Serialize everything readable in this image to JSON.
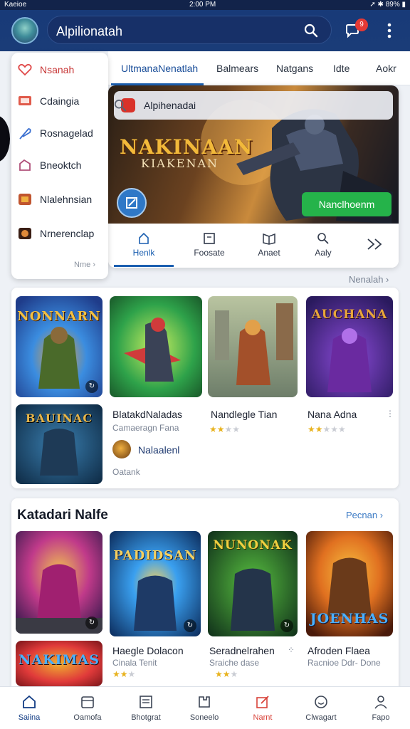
{
  "status_bar": {
    "left": "Kaeioe",
    "time": "2:00 PM",
    "right": "89%"
  },
  "app_bar": {
    "search_text": "Alpilionatah",
    "notification_badge": "9"
  },
  "top_tabs": [
    "UltmanaNenatlah",
    "Balmears",
    "Natgans",
    "Idte",
    "Aokr"
  ],
  "side_menu": {
    "items": [
      {
        "label": "Nsanah",
        "icon": "heart-icon",
        "color": "#e04848"
      },
      {
        "label": "Cdaingia",
        "icon": "tv-icon",
        "color": "#e05a4a"
      },
      {
        "label": "Rosnagelad",
        "icon": "feather-icon",
        "color": "#3a6fd0"
      },
      {
        "label": "Bneoktch",
        "icon": "controller-icon",
        "color": "#b0507a"
      },
      {
        "label": "Nlalehnsian",
        "icon": "game-thumb-icon",
        "color": "#c0552f"
      },
      {
        "label": "Nrnerenclap",
        "icon": "mask-icon",
        "color": "#8a4a2a"
      }
    ],
    "more": "Nme"
  },
  "hero": {
    "search_text": "Alpihenadai",
    "title": "NAKINAAN",
    "subtitle": "KIAKENAN",
    "cta": "Nanclhoenm",
    "nav": [
      {
        "label": "Henlk",
        "icon": "home-icon"
      },
      {
        "label": "Foosate",
        "icon": "square-icon"
      },
      {
        "label": "Anaet",
        "icon": "book-icon"
      },
      {
        "label": "Aaly",
        "icon": "search-icon"
      },
      {
        "label": "",
        "icon": "double-chevron-icon"
      }
    ]
  },
  "section1": {
    "see_all": "Nenalah",
    "covers": [
      {
        "title": "NONNARN",
        "colors": [
          "#1f3c8a",
          "#3b8de0",
          "#f0a030"
        ]
      },
      {
        "title": "",
        "colors": [
          "#2ea24a",
          "#c9ee60",
          "#d03b3b"
        ]
      },
      {
        "title": "",
        "colors": [
          "#6e7e6a",
          "#b9c4a0",
          "#a3502a"
        ]
      },
      {
        "title": "AUCHANA",
        "colors": [
          "#2a1a5e",
          "#8b4ad8",
          "#e8a63a"
        ]
      },
      {
        "title": "BAUINAC",
        "colors": [
          "#0e2a44",
          "#3a7fb0",
          "#e6b54a"
        ]
      }
    ],
    "featured": {
      "name": "BlatakdNaladas",
      "sub": "Camaeragn Fana",
      "dev": "Nalaalenl",
      "extra": "Oatank"
    },
    "games": [
      {
        "name": "Nandlegle Tian",
        "stars": 2
      },
      {
        "name": "Nana Adna",
        "stars": 2
      }
    ]
  },
  "section2": {
    "title": "Katadari Nalfe",
    "see_all": "Pecnan",
    "covers": [
      {
        "title": "",
        "colors": [
          "#3a1a4e",
          "#c03a8a",
          "#f0c050"
        ]
      },
      {
        "title": "PADIDSAN",
        "colors": [
          "#0c2c5c",
          "#3aa0f0",
          "#f4d060"
        ]
      },
      {
        "title": "NUNONAK",
        "colors": [
          "#10301a",
          "#58c040",
          "#f0d040"
        ]
      },
      {
        "title": "JOENHAS",
        "colors": [
          "#4a1a0a",
          "#e07020",
          "#f8c040"
        ]
      },
      {
        "title": "NAKIMAS",
        "colors": [
          "#5a0a10",
          "#e03a3a",
          "#f0b030"
        ]
      }
    ],
    "games": [
      {
        "name": "Haegle Dolacon",
        "sub": "Cinala Tenit",
        "stars": 2
      },
      {
        "name": "Seradnelrahen",
        "sub": "Sraiche dase",
        "stars": 2
      },
      {
        "name": "Afroden Flaea",
        "sub": "Racnioe Ddr- Done",
        "stars": 0
      }
    ]
  },
  "bottom_nav": [
    {
      "label": "Saiina",
      "icon": "home-icon"
    },
    {
      "label": "Oamofa",
      "icon": "calendar-icon"
    },
    {
      "label": "Bhotgrat",
      "icon": "news-icon"
    },
    {
      "label": "Soneelo",
      "icon": "puzzle-icon"
    },
    {
      "label": "Narnt",
      "icon": "edit-icon"
    },
    {
      "label": "Clwagart",
      "icon": "smile-icon"
    },
    {
      "label": "Fapo",
      "icon": "person-icon"
    }
  ]
}
